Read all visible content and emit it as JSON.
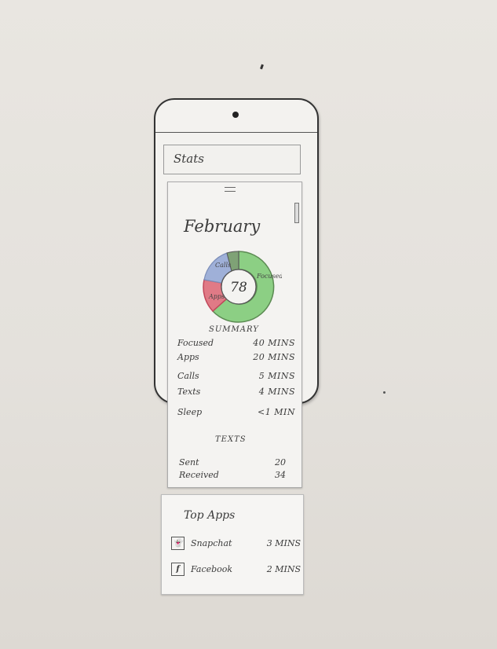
{
  "header": {
    "title": "Stats"
  },
  "detail": {
    "month": "February",
    "score": "78",
    "chart_labels": {
      "calls": "Calls",
      "apps": "Apps",
      "focused": "Focused"
    },
    "summary_title": "SUMMARY",
    "summary": [
      {
        "label": "Focused",
        "value": "40 MINS"
      },
      {
        "label": "Apps",
        "value": "20 MINS"
      },
      {
        "label": "Calls",
        "value": "5 MINS"
      },
      {
        "label": "Texts",
        "value": "4 MINS"
      },
      {
        "label": "Sleep",
        "value": "<1 MIN"
      }
    ],
    "texts_title": "TEXTS",
    "texts": [
      {
        "label": "Sent",
        "value": "20"
      },
      {
        "label": "Received",
        "value": "34"
      }
    ]
  },
  "top_apps": {
    "title": "Top Apps",
    "items": [
      {
        "name": "Snapchat",
        "value": "3 MINS",
        "icon": "snapchat-icon"
      },
      {
        "name": "Facebook",
        "value": "2 MINS",
        "icon": "facebook-icon"
      }
    ]
  },
  "colors": {
    "focused": "#8ccf84",
    "apps": "#e07a86",
    "calls": "#9fb0d8",
    "texts": "#7fa276",
    "sleep": "#c9c9c9"
  }
}
